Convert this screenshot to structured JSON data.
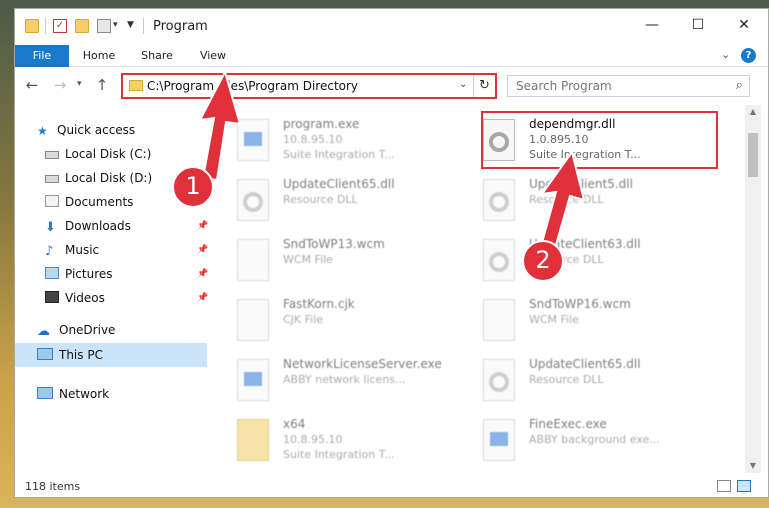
{
  "window": {
    "title": "Program"
  },
  "ribbon": {
    "tabs": [
      "File",
      "Home",
      "Share",
      "View"
    ]
  },
  "address": {
    "path": "C:\\Program Files\\Program Directory"
  },
  "search": {
    "placeholder": "Search Program"
  },
  "sidebar": {
    "items": [
      {
        "label": "Quick access",
        "icon": "star-icon"
      },
      {
        "label": "Local Disk (C:)",
        "icon": "drive-icon"
      },
      {
        "label": "Local Disk (D:)",
        "icon": "drive-icon"
      },
      {
        "label": "Documents",
        "icon": "documents-icon"
      },
      {
        "label": "Downloads",
        "icon": "download-icon",
        "pinned": true
      },
      {
        "label": "Music",
        "icon": "music-icon",
        "pinned": true
      },
      {
        "label": "Pictures",
        "icon": "pictures-icon",
        "pinned": true
      },
      {
        "label": "Videos",
        "icon": "videos-icon",
        "pinned": true
      },
      {
        "label": "OneDrive",
        "icon": "cloud-icon"
      },
      {
        "label": "This PC",
        "icon": "pc-icon",
        "selected": true
      },
      {
        "label": "Network",
        "icon": "network-icon"
      }
    ]
  },
  "files": [
    {
      "name": "program.exe",
      "line2": "10.8.95.10",
      "line3": "Suite Integration T...",
      "icon": "exe-icon"
    },
    {
      "name": "dependmgr.dll",
      "line2": "1.0.895.10",
      "line3": "Suite Integration T...",
      "icon": "dll-gear-icon",
      "highlighted": true
    },
    {
      "name": "UpdateClient65.dll",
      "line2": "Resource DLL",
      "line3": "",
      "icon": "dll-gear-icon"
    },
    {
      "name": "UpdateClient5.dll",
      "line2": "Resource DLL",
      "line3": "",
      "icon": "dll-gear-icon"
    },
    {
      "name": "SndToWP13.wcm",
      "line2": "WCM File",
      "line3": "",
      "icon": "file-icon"
    },
    {
      "name": "UpdateClient63.dll",
      "line2": "Resource DLL",
      "line3": "",
      "icon": "dll-gear-icon"
    },
    {
      "name": "FastKorn.cjk",
      "line2": "CJK File",
      "line3": "",
      "icon": "file-icon"
    },
    {
      "name": "SndToWP16.wcm",
      "line2": "WCM File",
      "line3": "",
      "icon": "file-icon"
    },
    {
      "name": "NetworkLicenseServer.exe",
      "line2": "ABBY network licens...",
      "line3": "",
      "icon": "exe-icon"
    },
    {
      "name": "UpdateClient65.dll",
      "line2": "Resource DLL",
      "line3": "",
      "icon": "dll-gear-icon"
    },
    {
      "name": "x64",
      "line2": "10.8.95.10",
      "line3": "Suite Integration T...",
      "icon": "folder-icon"
    },
    {
      "name": "FineExec.exe",
      "line2": "ABBY background exe...",
      "line3": "",
      "icon": "exe-icon"
    }
  ],
  "status": {
    "item_count": "118 items"
  },
  "annotations": {
    "badge1": "1",
    "badge2": "2"
  },
  "colors": {
    "accent": "#1979ca",
    "annotation_red": "#e0303a",
    "selection": "#cce4f7"
  }
}
